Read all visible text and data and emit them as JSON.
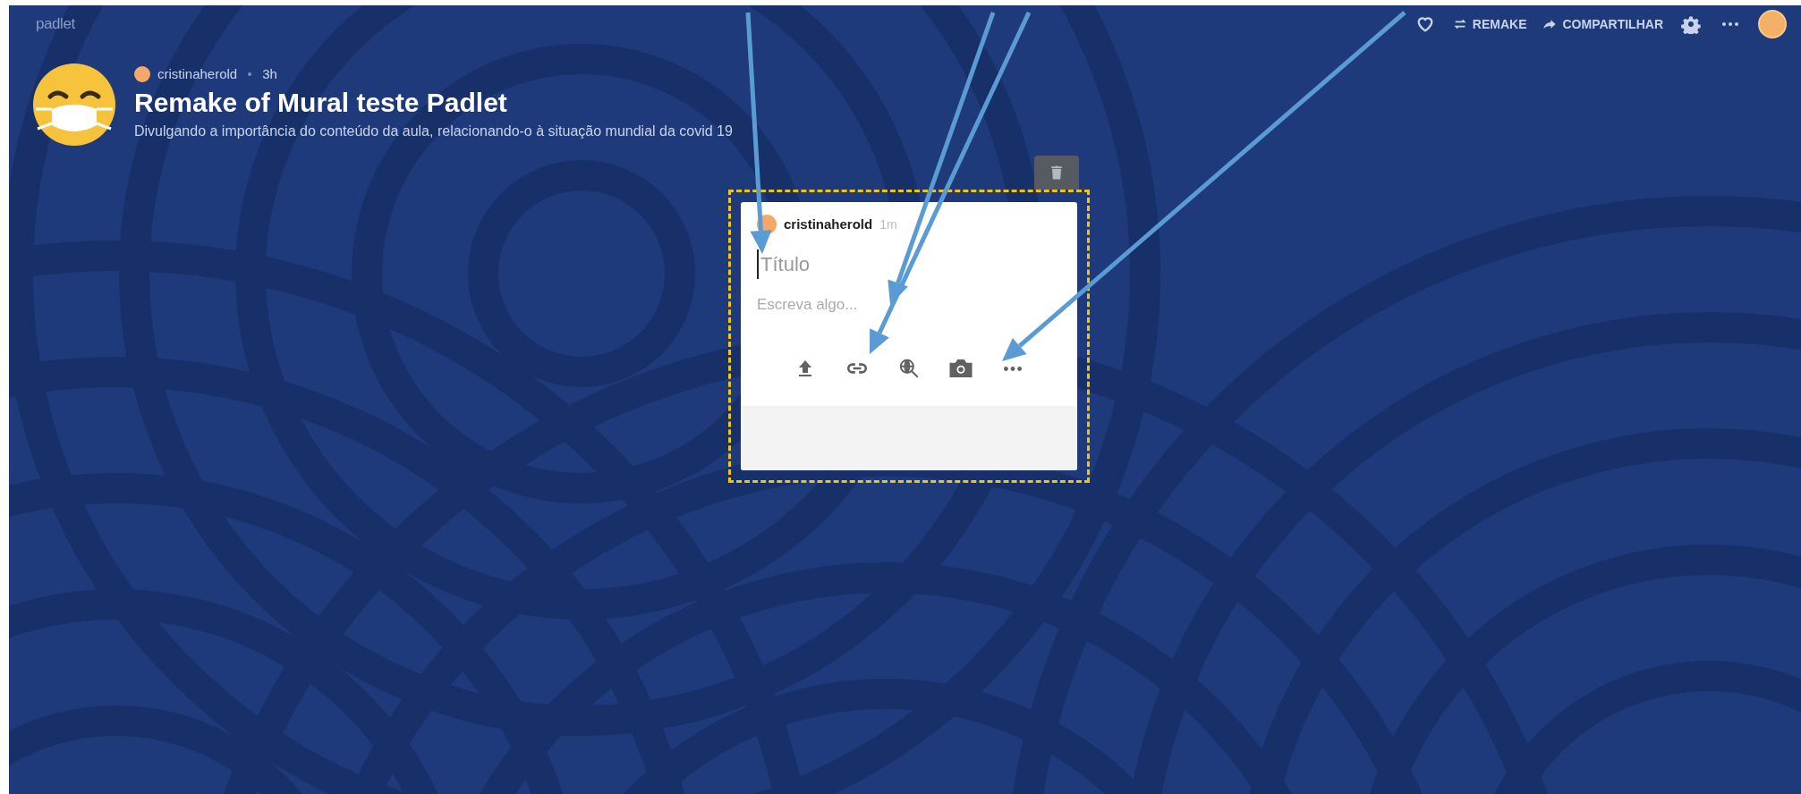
{
  "app": {
    "logo": "padlet"
  },
  "toolbar": {
    "liked": false,
    "actions": [
      {
        "kind": "remake",
        "label": "REMAKE"
      },
      {
        "kind": "share",
        "label": "COMPARTILHAR"
      },
      {
        "kind": "settings"
      },
      {
        "kind": "more"
      }
    ]
  },
  "board": {
    "author": "cristinaherold",
    "age": "3h",
    "title": "Remake of Mural teste Padlet",
    "description": "Divulgando a importância do conteúdo da aula, relacionando-o à situação mundial da covid 19"
  },
  "post": {
    "author": "cristinaherold",
    "age": "1m",
    "title_placeholder": "Título",
    "body_placeholder": "Escreva algo...",
    "attachments": [
      {
        "kind": "upload"
      },
      {
        "kind": "link"
      },
      {
        "kind": "search"
      },
      {
        "kind": "camera"
      },
      {
        "kind": "more"
      }
    ]
  }
}
